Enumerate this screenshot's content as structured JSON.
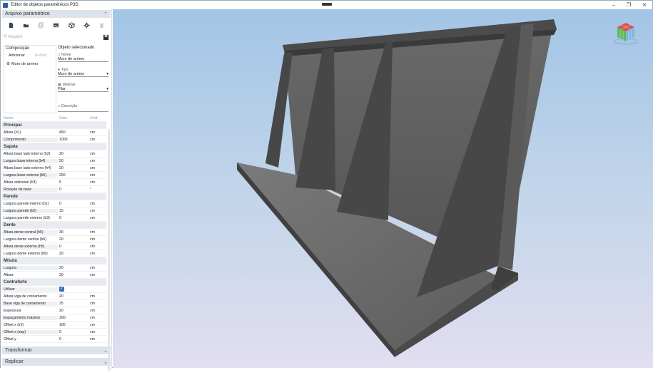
{
  "window": {
    "title": "Editor de objetos paramétricos P3D"
  },
  "panel": {
    "arquivo_header": "Arquivo paramétrico",
    "arquivo_label": "Arquivo",
    "composicao": {
      "title": "Composição",
      "tab_add": "Adicionar",
      "tab_remove": "Excluir",
      "item": "Muro de arrimo"
    },
    "objeto": {
      "title": "Objeto selecionado",
      "nome_label": "Nome",
      "nome_value": "Muro de arrimo",
      "tipo_label": "Tipo",
      "tipo_value": "Muro de arrimo",
      "material_label": "Material",
      "material_value": "Pilar",
      "descricao_label": "Descrição"
    },
    "table_header": {
      "name": "Nome",
      "value": "Valor",
      "unit": "Unid."
    },
    "groups": [
      {
        "title": "Principal",
        "rows": [
          {
            "label": "Altura (h1)",
            "value": "450",
            "unit": "cm"
          },
          {
            "label": "Comprimento",
            "value": "1000",
            "unit": "cm"
          }
        ]
      },
      {
        "title": "Sapata",
        "rows": [
          {
            "label": "Altura base lado interno (h2)",
            "value": "20",
            "unit": "cm"
          },
          {
            "label": "Largura base interna (b4)",
            "value": "50",
            "unit": "cm"
          },
          {
            "label": "Altura base lado externo (h4)",
            "value": "20",
            "unit": "cm"
          },
          {
            "label": "Largura base externa (b5)",
            "value": "250",
            "unit": "cm"
          },
          {
            "label": "Altura adicional (h3)",
            "value": "5",
            "unit": "cm"
          },
          {
            "label": "Rotação da base",
            "value": "0",
            "unit": "°"
          }
        ]
      },
      {
        "title": "Parede",
        "rows": [
          {
            "label": "Largura parede interno (b1)",
            "value": "0",
            "unit": "cm"
          },
          {
            "label": "Largura parede (b2)",
            "value": "15",
            "unit": "cm"
          },
          {
            "label": "Largura parede externo (b3)",
            "value": "0",
            "unit": "cm"
          }
        ]
      },
      {
        "title": "Dente",
        "rows": [
          {
            "label": "Altura dente central (h5)",
            "value": "30",
            "unit": "cm"
          },
          {
            "label": "Largura dente central (b6)",
            "value": "20",
            "unit": "cm"
          },
          {
            "label": "Altura dente externo (h5)",
            "value": "0",
            "unit": "cm"
          },
          {
            "label": "Largura dente externo (b6)",
            "value": "20",
            "unit": "cm"
          }
        ]
      },
      {
        "title": "Mísula",
        "rows": [
          {
            "label": "Largura",
            "value": "20",
            "unit": "cm"
          },
          {
            "label": "Altura",
            "value": "20",
            "unit": "cm"
          }
        ]
      },
      {
        "title": "Contraforte",
        "rows": [
          {
            "label": "Utilizar",
            "value": "",
            "unit": "",
            "checkbox": true
          },
          {
            "label": "Altura viga de coroamento",
            "value": "20",
            "unit": "cm"
          },
          {
            "label": "Base viga de coroamento",
            "value": "25",
            "unit": "cm"
          },
          {
            "label": "Espessura",
            "value": "20",
            "unit": "cm"
          },
          {
            "label": "Espaçamento máximo",
            "value": "300",
            "unit": "cm"
          },
          {
            "label": "Offset x (inf)",
            "value": "100",
            "unit": "cm"
          },
          {
            "label": "Offset x (sup)",
            "value": "0",
            "unit": "cm"
          },
          {
            "label": "Offset y",
            "value": "0",
            "unit": "cm"
          }
        ]
      }
    ],
    "transformar_header": "Transformar",
    "replicar_header": "Replicar"
  },
  "colors": {
    "accent": "#3a6fb0",
    "concrete": "#5d5d5d",
    "sky_top": "#a3c5e6",
    "sky_bottom": "#e2def0"
  },
  "icons": [
    "new-file-icon",
    "open-folder-icon",
    "copy-icon",
    "image-icon",
    "cube-icon",
    "gear-icon",
    "trash-icon",
    "save-icon",
    "view-cube-icon"
  ]
}
